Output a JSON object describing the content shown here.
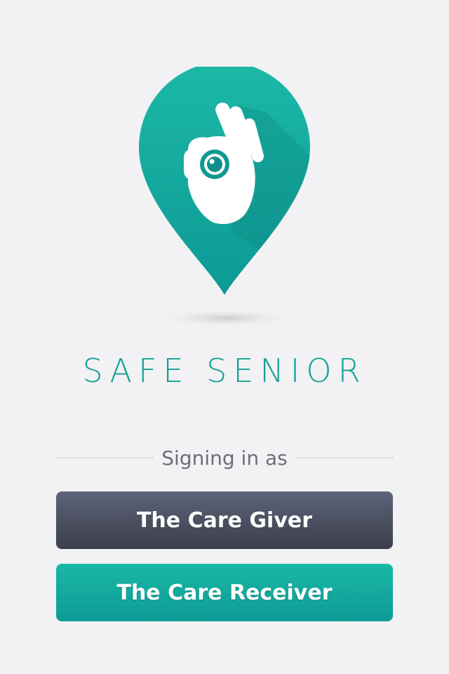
{
  "app": {
    "title": "SAFE SENIOR",
    "logo": "ok-hand-location-pin-icon"
  },
  "signin": {
    "prompt": "Signing in as",
    "options": [
      {
        "label": "The Care Giver",
        "color": "#4a4f60"
      },
      {
        "label": "The Care Receiver",
        "color": "#14ad9f"
      }
    ]
  },
  "colors": {
    "background": "#f2f2f4",
    "brand_teal": "#15a096",
    "dark_button": "#4a4f60"
  }
}
